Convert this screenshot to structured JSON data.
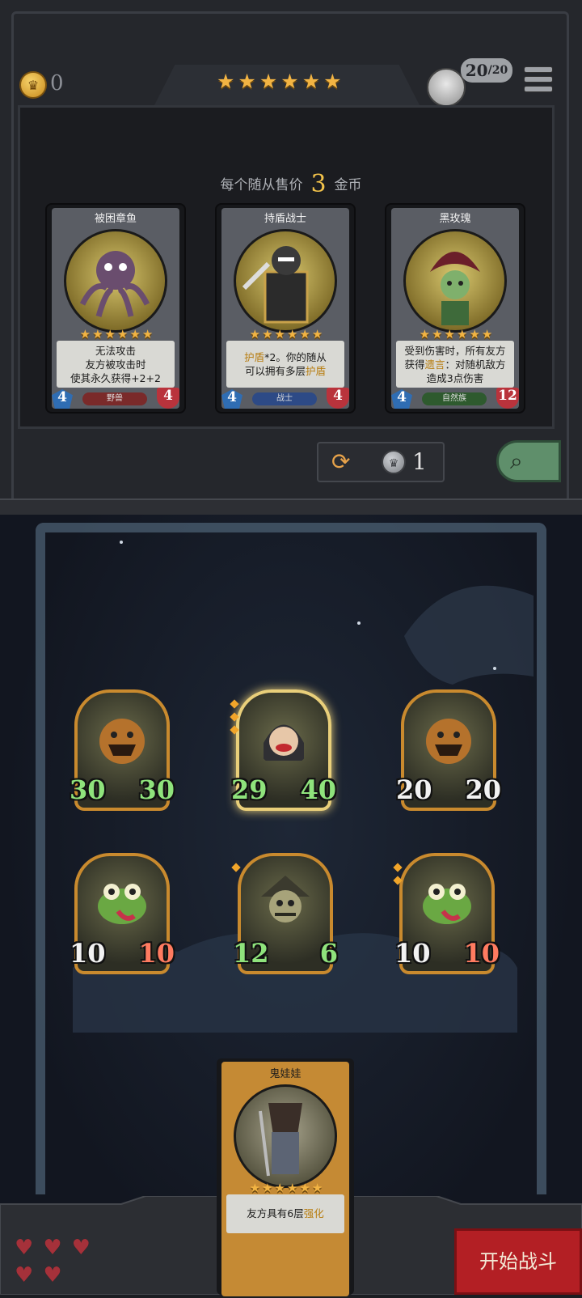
{
  "topbar": {
    "gold": "0",
    "tavern_stars": 6,
    "level_text": "20",
    "level_max": "/20"
  },
  "shop": {
    "price_prefix": "每个随从售价",
    "price_value": "3",
    "price_suffix": "金币",
    "cards": [
      {
        "name": "被困章鱼",
        "stars": 6,
        "desc_lines": [
          "无法攻击",
          "友方被攻击时",
          "使其永久获得+2+2"
        ],
        "attack": "4",
        "health": "4",
        "tribe": "野兽",
        "tribe_color": "#7a2a2a"
      },
      {
        "name": "持盾战士",
        "stars": 6,
        "desc_parts": [
          "护盾",
          "*2。你的随从",
          "可以拥有多层",
          "护盾"
        ],
        "attack": "4",
        "health": "4",
        "tribe": "战士",
        "tribe_color": "#2d4a86"
      },
      {
        "name": "黑玫瑰",
        "stars": 6,
        "desc_parts": [
          "受到伤害时，所有友方",
          "获得",
          "遗言",
          "：对随机敌方",
          "造成3点伤害"
        ],
        "attack": "4",
        "health": "12",
        "tribe": "自然族",
        "tribe_color": "#2e5a2e"
      }
    ],
    "refresh_cost": "1"
  },
  "board": {
    "minions": [
      {
        "attack": "30",
        "health": "30",
        "atk_color": "green",
        "hp_color": "green"
      },
      {
        "attack": "29",
        "health": "40",
        "atk_color": "green",
        "hp_color": "green"
      },
      {
        "attack": "20",
        "health": "20",
        "atk_color": "white",
        "hp_color": "white"
      },
      {
        "attack": "10",
        "health": "10",
        "atk_color": "white",
        "hp_color": "red"
      },
      {
        "attack": "12",
        "health": "6",
        "atk_color": "green",
        "hp_color": "green"
      },
      {
        "attack": "10",
        "health": "10",
        "atk_color": "white",
        "hp_color": "red"
      }
    ]
  },
  "hand": {
    "name": "鬼娃娃",
    "stars": 6,
    "desc_prefix": "友方具有6层",
    "desc_highlight": "强化"
  },
  "bottom": {
    "hearts": 5,
    "start_label": "开始战斗"
  },
  "colors": {
    "gold": "#f2b443",
    "accent_red": "#b31f24"
  }
}
